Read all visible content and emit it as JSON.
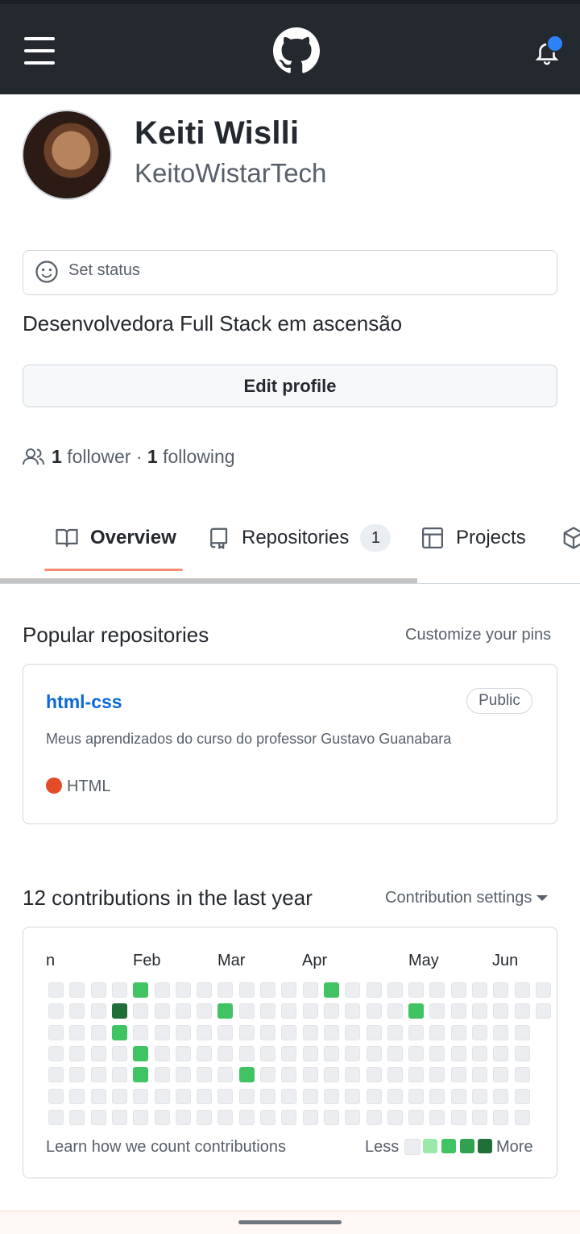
{
  "profile": {
    "name": "Keiti Wislli",
    "login": "KeitoWistarTech",
    "status_placeholder": "Set status",
    "bio": "Desenvolvedora Full Stack em ascensão",
    "edit_label": "Edit profile",
    "followers_count": "1",
    "followers_label": "follower",
    "separator": "·",
    "following_count": "1",
    "following_label": "following"
  },
  "tabs": [
    {
      "label": "Overview",
      "icon": "book-icon",
      "active": true
    },
    {
      "label": "Repositories",
      "icon": "repo-icon",
      "count": "1"
    },
    {
      "label": "Projects",
      "icon": "table-icon"
    },
    {
      "label": "",
      "icon": "package-icon"
    }
  ],
  "popular": {
    "title": "Popular repositories",
    "customize_label": "Customize your pins",
    "repos": [
      {
        "name": "html-css",
        "visibility": "Public",
        "description": "Meus aprendizados do curso do professor Gustavo Guanabara",
        "language": "HTML",
        "language_color": "#e34c26"
      }
    ]
  },
  "contributions": {
    "title": "12 contributions in the last year",
    "settings_label": "Contribution settings",
    "months": [
      "n",
      "Feb",
      "Mar",
      "Apr",
      "May",
      "Jun"
    ],
    "learn_label": "Learn how we count contributions",
    "legend_less": "Less",
    "legend_more": "More",
    "colors": {
      "empty": "#ebedf0",
      "l1": "#9be9a8",
      "l2": "#40c463",
      "l3": "#30a14e",
      "l4": "#216e39"
    },
    "grid": [
      [
        0,
        0,
        0,
        0,
        2,
        0,
        0,
        0,
        0,
        0,
        0,
        0,
        0,
        2,
        0,
        0,
        0,
        0,
        0,
        0,
        0,
        0,
        0,
        0
      ],
      [
        0,
        0,
        0,
        4,
        0,
        0,
        0,
        0,
        2,
        0,
        0,
        0,
        0,
        0,
        0,
        0,
        0,
        2,
        0,
        0,
        0,
        0,
        0,
        0
      ],
      [
        0,
        0,
        0,
        2,
        0,
        0,
        0,
        0,
        0,
        0,
        0,
        0,
        0,
        0,
        0,
        0,
        0,
        0,
        0,
        0,
        0,
        0,
        0
      ],
      [
        0,
        0,
        0,
        0,
        2,
        0,
        0,
        0,
        0,
        0,
        0,
        0,
        0,
        0,
        0,
        0,
        0,
        0,
        0,
        0,
        0,
        0,
        0
      ],
      [
        0,
        0,
        0,
        0,
        2,
        0,
        0,
        0,
        0,
        2,
        0,
        0,
        0,
        0,
        0,
        0,
        0,
        0,
        0,
        0,
        0,
        0,
        0
      ],
      [
        0,
        0,
        0,
        0,
        0,
        0,
        0,
        0,
        0,
        0,
        0,
        0,
        0,
        0,
        0,
        0,
        0,
        0,
        0,
        0,
        0,
        0,
        0
      ],
      [
        0,
        0,
        0,
        0,
        0,
        0,
        0,
        0,
        0,
        0,
        0,
        0,
        0,
        0,
        0,
        0,
        0,
        0,
        0,
        0,
        0,
        0,
        0
      ]
    ]
  }
}
